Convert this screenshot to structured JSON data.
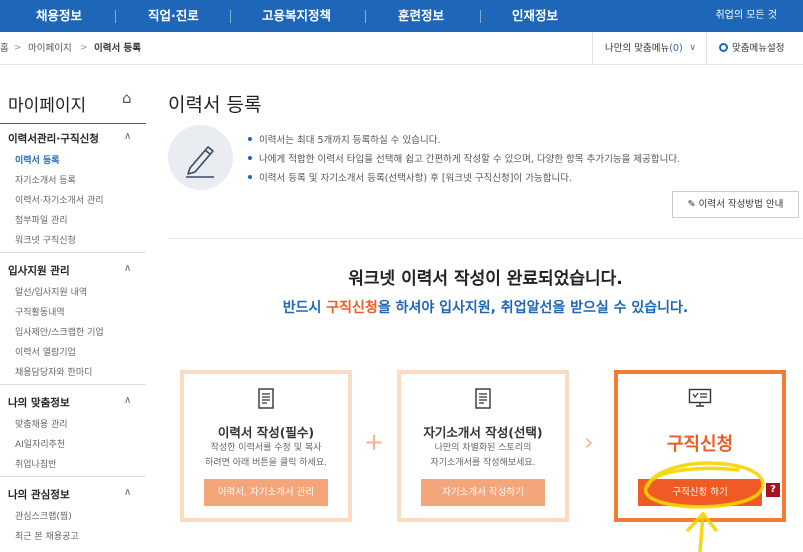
{
  "topnav": {
    "items": [
      "채용정보",
      "직업·진로",
      "고용복지정책",
      "훈련정보",
      "인재정보"
    ],
    "util": "취업의 모든 것"
  },
  "breadcrumb": {
    "home": "홈",
    "mypage": "마이페이지",
    "current": "이력서 등록"
  },
  "mymenu": {
    "label": "나만의 맞춤메뉴",
    "count": "(0)",
    "settings": "맞춤메뉴설정"
  },
  "sidebar": {
    "title": "마이페이지",
    "sections": [
      {
        "heading": "이력서관리·구직신청",
        "items": [
          "이력서 등록",
          "자기소개서 등록",
          "이력서·자기소개서 관리",
          "첨부파일 관리",
          "워크넷 구직신청"
        ]
      },
      {
        "heading": "입사지원 관리",
        "items": [
          "알선/입사지원 내역",
          "구직활동내역",
          "입사제안/스크랩한 기업",
          "이력서 열람기업",
          "채용담당자와 한마디"
        ]
      },
      {
        "heading": "나의 맞춤정보",
        "items": [
          "맞춤채용 관리",
          "AI일자리추천",
          "취업나침반"
        ]
      },
      {
        "heading": "나의 관심정보",
        "items": [
          "관심스크랩(찜)",
          "최근 본 채용공고"
        ]
      }
    ]
  },
  "main": {
    "title": "이력서 등록",
    "notices": [
      "이력서는 최대 5개까지 등록하실 수 있습니다.",
      "나에게 적합한 이력서 타입을 선택해 쉽고 간편하게 작성할 수 있으며, 다양한 항목 추가기능을 제공합니다.",
      "이력서 등록 및 자기소개서 등록(선택사항) 후 [워크넷 구직신청]이 가능합니다."
    ],
    "guide_button": "이력서 작성방법 안내",
    "done_message": "워크넷 이력서 작성이 완료되었습니다.",
    "must_pre": "반드시 ",
    "must_hl": "구직신청",
    "must_post": "을 하셔야 입사지원, 취업알선을 받으실 수 있습니다."
  },
  "steps": {
    "resume": {
      "title": "이력서 작성(필수)",
      "desc1": "작성한 이력서를 수정 및 복사",
      "desc2": "하려면 아래 버튼을 클릭 하세요.",
      "button": "이력서, 자기소개서 관리"
    },
    "cover": {
      "title": "자기소개서 작성(선택)",
      "desc1": "나만의 차별화된 스토리의",
      "desc2": "자기소개서를 작성해보세요.",
      "button": "자기소개서 작성하기"
    },
    "apply": {
      "title": "구직신청",
      "button": "구직신청 하기",
      "help": "?"
    }
  },
  "colors": {
    "brand": "#1e66b7",
    "accent": "#f05a24",
    "annotation": "#f5d400"
  }
}
